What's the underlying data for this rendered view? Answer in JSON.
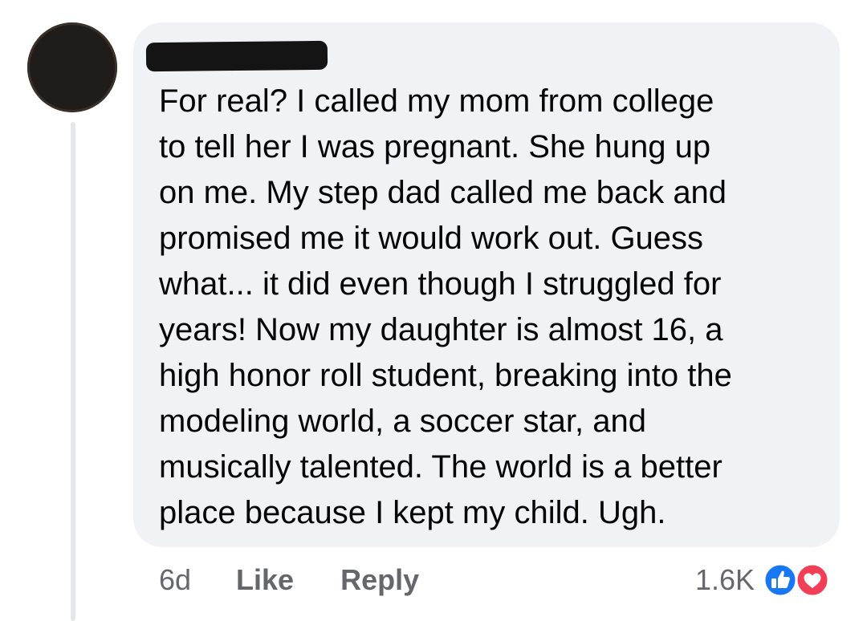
{
  "comment": {
    "author_name": "",
    "text": "For real? I called my mom from college\nto tell her I was pregnant. She hung up\non me. My step dad called me back and\npromised me it would work out. Guess\nwhat... it did even though I struggled for\nyears!  Now my daughter is almost 16, a\nhigh honor roll student, breaking into the\nmodeling world, a soccer star, and\nmusically talented.  The world is a better\nplace because I kept my child. Ugh.",
    "time": "6d",
    "like_label": "Like",
    "reply_label": "Reply",
    "reaction_count": "1.6K",
    "reactions": [
      "like-icon",
      "love-icon"
    ]
  },
  "colors": {
    "bubble_bg": "#f0f2f5",
    "text": "#050505",
    "meta": "#65676b",
    "like_blue": "#1877f2",
    "love_red": "#f33e58"
  }
}
